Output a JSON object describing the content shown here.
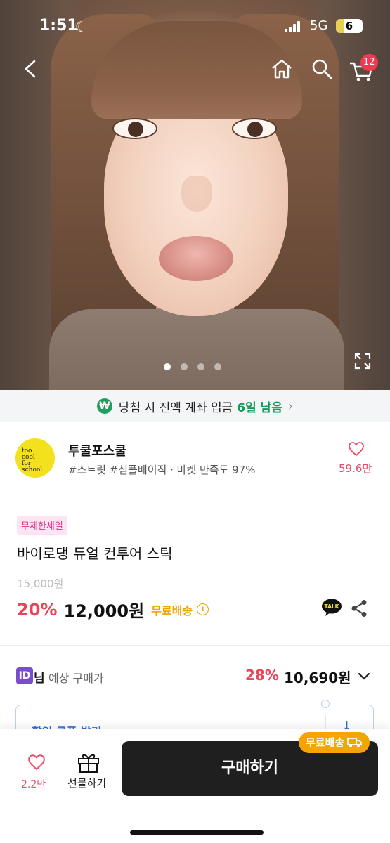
{
  "status_bar": {
    "time": "1:51",
    "network": "5G",
    "battery": "6"
  },
  "header": {
    "cart_count": "12"
  },
  "carousel": {
    "total": 4,
    "active_index": 0
  },
  "banner": {
    "text": "당첨 시 전액 계좌 입금",
    "highlight": "6일 남음"
  },
  "seller": {
    "name": "투쿨포스쿨",
    "tags": "#스트릿 #심플베이직 · 마켓 만족도 97%",
    "like_count": "59.6만",
    "logo_text": "too cool for school"
  },
  "product": {
    "badge": "무제한세일",
    "title": "바이로댕 듀얼 컨투어 스틱",
    "original_price": "15,000원",
    "discount": "20%",
    "price": "12,000원",
    "shipping": "무료배송"
  },
  "expected": {
    "id_badge": "ID",
    "id_suffix": "님",
    "label": "예상 구매가",
    "discount": "28%",
    "price": "10,690원"
  },
  "coupon": {
    "label": "할인 쿠폰 받기"
  },
  "bottom_bar": {
    "like_count": "2.2만",
    "gift_label": "선물하기",
    "buy_label": "구매하기",
    "shipping_pill": "무료배송"
  },
  "colors": {
    "accent_pink": "#e8445a",
    "shipping_orange": "#f0a400",
    "green": "#17995a",
    "dark_button": "#1f1f20"
  }
}
